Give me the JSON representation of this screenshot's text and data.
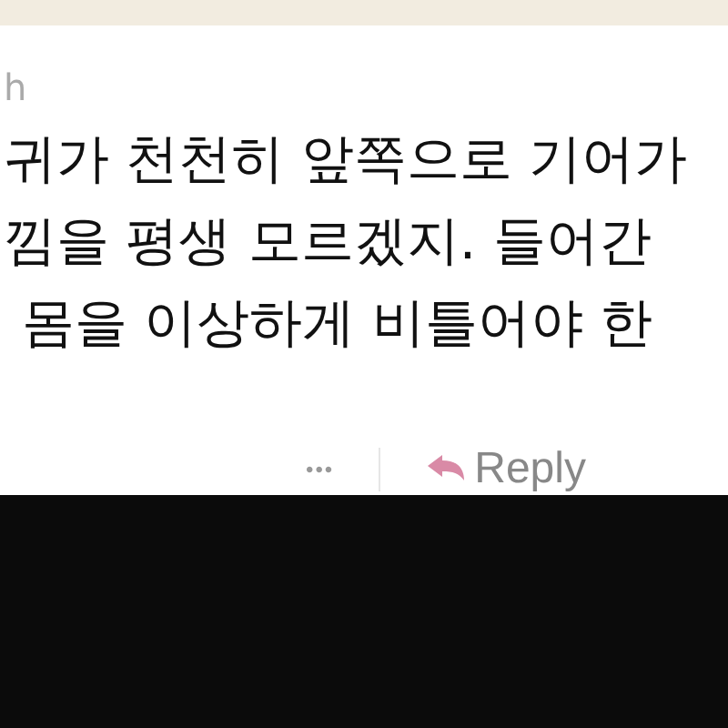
{
  "comment": {
    "author": "h",
    "lines": [
      "귀가 천천히 앞쪽으로 기어가",
      "낌을 평생 모르겠지. 들어간",
      "몸을 이상하게 비틀어야 한"
    ],
    "more_button": "•••",
    "reply_button": "Reply"
  }
}
